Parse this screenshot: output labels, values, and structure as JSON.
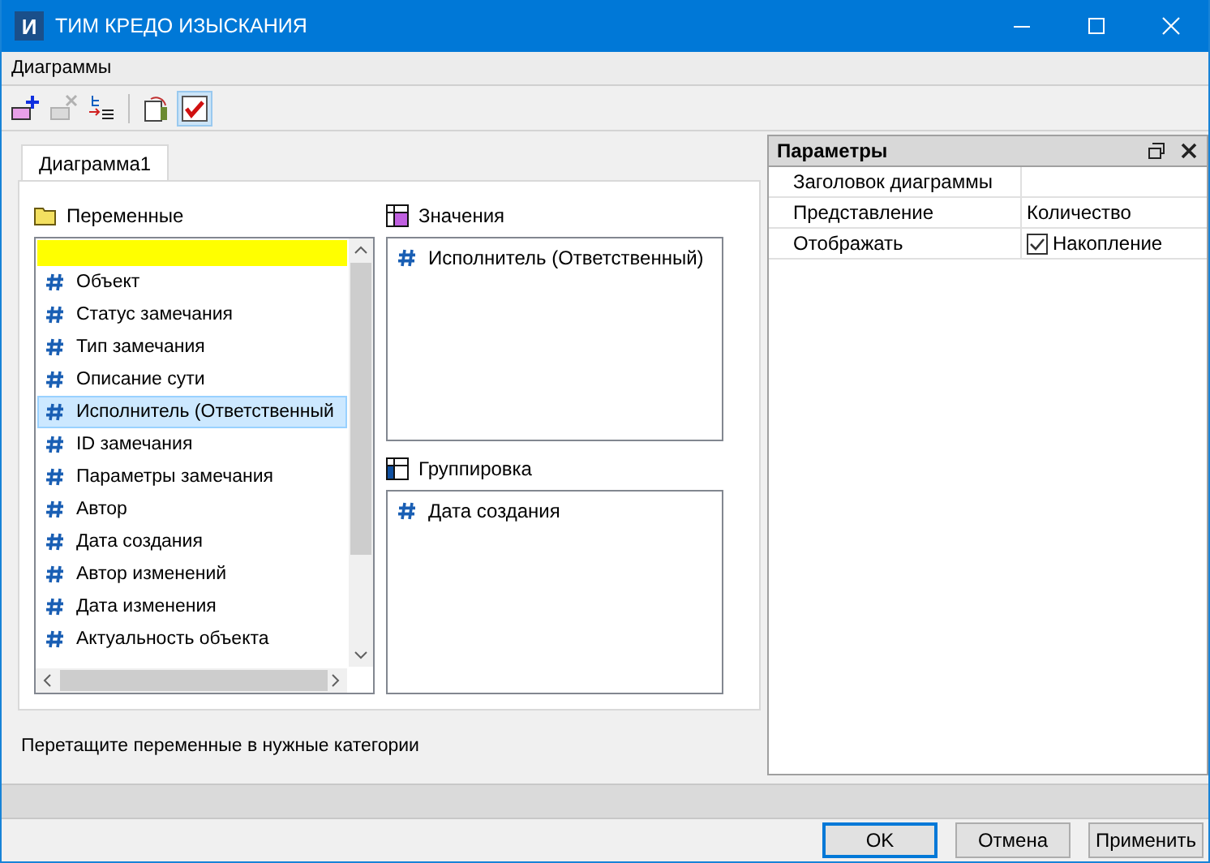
{
  "window": {
    "icon_letter": "И",
    "title": "ТИМ КРЕДО ИЗЫСКАНИЯ"
  },
  "menu": [
    "Диаграммы"
  ],
  "toolbar": [
    {
      "kind": "add",
      "disabled": false,
      "pressed": false
    },
    {
      "kind": "remove",
      "disabled": true,
      "pressed": false
    },
    {
      "kind": "move",
      "disabled": false,
      "pressed": false
    },
    {
      "kind": "export",
      "disabled": false,
      "pressed": false
    },
    {
      "kind": "check",
      "disabled": false,
      "pressed": true
    }
  ],
  "tabs": [
    {
      "label": "Диаграмма1",
      "selected": true
    }
  ],
  "variables": {
    "title": "Переменные",
    "items": [
      {
        "label": "Объект",
        "selected": false
      },
      {
        "label": "Статус замечания",
        "selected": false
      },
      {
        "label": "Тип замечания",
        "selected": false
      },
      {
        "label": "Описание сути",
        "selected": false
      },
      {
        "label": "Исполнитель (Ответственный",
        "selected": true
      },
      {
        "label": "ID замечания",
        "selected": false
      },
      {
        "label": "Параметры замечания",
        "selected": false
      },
      {
        "label": "Автор",
        "selected": false
      },
      {
        "label": "Дата создания",
        "selected": false
      },
      {
        "label": "Автор изменений",
        "selected": false
      },
      {
        "label": "Дата изменения",
        "selected": false
      },
      {
        "label": "Актуальность объекта",
        "selected": false
      }
    ]
  },
  "values": {
    "title": "Значения",
    "items": [
      "Исполнитель (Ответственный)"
    ]
  },
  "grouping": {
    "title": "Группировка",
    "items": [
      "Дата создания"
    ]
  },
  "hint": "Перетащите переменные в нужные категории",
  "parameters": {
    "title": "Параметры",
    "rows": [
      {
        "kind": "text",
        "name": "Заголовок диаграммы"
      },
      {
        "kind": "text",
        "name": "Представление",
        "value": "Количество"
      },
      {
        "kind": "checkbox",
        "name": "Отображать",
        "value": "Накопление",
        "checked": true
      }
    ]
  },
  "buttons": [
    {
      "label": "OK",
      "default": true
    },
    {
      "label": "Отмена",
      "default": false
    },
    {
      "label": "Применить",
      "default": false
    }
  ]
}
